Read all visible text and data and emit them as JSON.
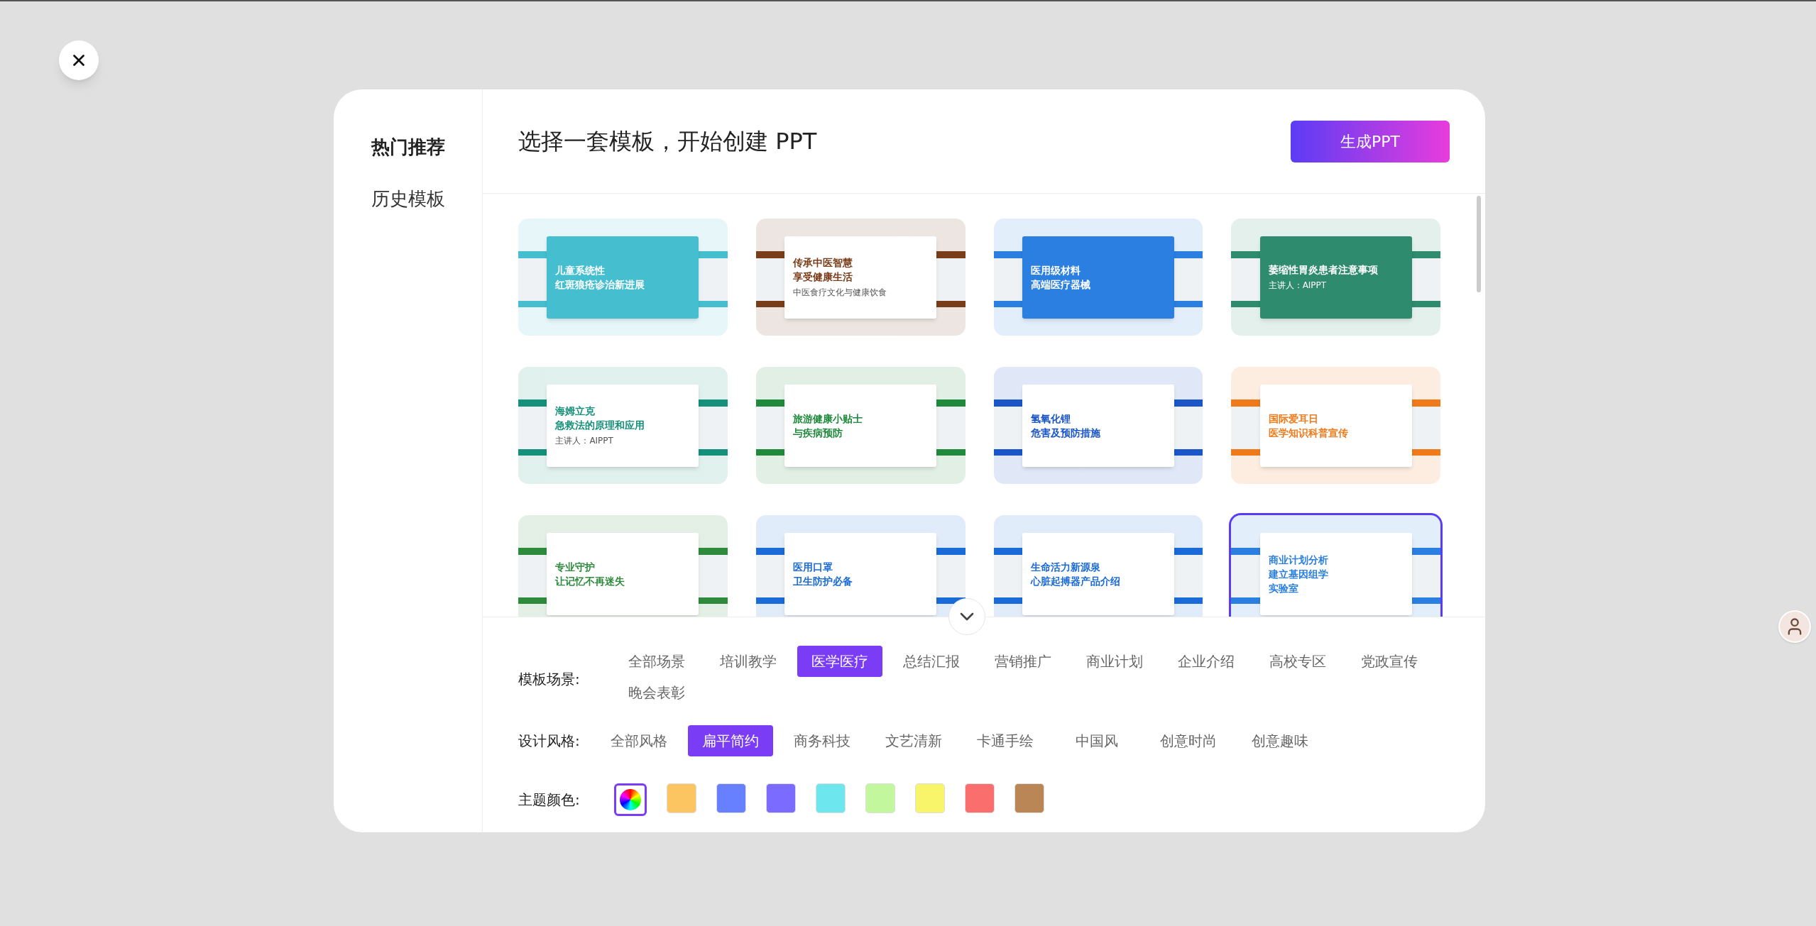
{
  "sidebar": {
    "items": [
      {
        "label": "热门推荐",
        "selected": true
      },
      {
        "label": "历史模板",
        "selected": false
      }
    ]
  },
  "header": {
    "title": "选择一套模板，开始创建 PPT",
    "generate_button": "生成PPT"
  },
  "templates": [
    {
      "kind": "filled",
      "color": "#45bfcf",
      "title_lines": [
        "儿童系统性",
        "红斑狼疮诊治新进展"
      ],
      "selected": false
    },
    {
      "kind": "plain",
      "color": "#7a3d1a",
      "title_lines": [
        "传承中医智慧",
        "享受健康生活"
      ],
      "subtitle": "中医食疗文化与健康饮食",
      "selected": false
    },
    {
      "kind": "filled",
      "color": "#2a7fe0",
      "title_lines": [
        "医用级材料",
        "高端医疗器械"
      ],
      "selected": false
    },
    {
      "kind": "filled",
      "color": "#2e8b6e",
      "title_lines": [
        "萎缩性胃炎患者注意事项"
      ],
      "subtitle": "主讲人：AIPPT",
      "selected": false
    },
    {
      "kind": "plain",
      "color": "#15907a",
      "title_lines": [
        "海姆立克",
        "急救法的原理和应用"
      ],
      "subtitle": "主讲人：AIPPT",
      "selected": false
    },
    {
      "kind": "plain",
      "color": "#1f8a3c",
      "title_lines": [
        "旅游健康小贴士",
        "与疾病预防"
      ],
      "selected": false
    },
    {
      "kind": "plain",
      "color": "#1a56c8",
      "title_lines": [
        "氢氧化锂",
        "危害及预防措施"
      ],
      "selected": false
    },
    {
      "kind": "plain",
      "color": "#f07a1a",
      "title_lines": [
        "国际爱耳日",
        "医学知识科普宣传"
      ],
      "selected": false
    },
    {
      "kind": "plain",
      "color": "#2e8b3c",
      "title_lines": [
        "专业守护",
        "让记忆不再迷失"
      ],
      "selected": false
    },
    {
      "kind": "plain",
      "color": "#1a6ad8",
      "title_lines": [
        "医用口罩",
        "卫生防护必备"
      ],
      "selected": false
    },
    {
      "kind": "plain",
      "color": "#1a6ad8",
      "title_lines": [
        "生命活力新源泉",
        "心脏起搏器产品介绍"
      ],
      "selected": false
    },
    {
      "kind": "plain",
      "color": "#2a7fe0",
      "title_lines": [
        "商业计划分析",
        "建立基因组学",
        "实验室"
      ],
      "selected": true
    }
  ],
  "filters": {
    "scene": {
      "label": "模板场景:",
      "options": [
        {
          "label": "全部场景",
          "selected": false
        },
        {
          "label": "培训教学",
          "selected": false
        },
        {
          "label": "医学医疗",
          "selected": true
        },
        {
          "label": "总结汇报",
          "selected": false
        },
        {
          "label": "营销推广",
          "selected": false
        },
        {
          "label": "商业计划",
          "selected": false
        },
        {
          "label": "企业介绍",
          "selected": false
        },
        {
          "label": "高校专区",
          "selected": false
        },
        {
          "label": "党政宣传",
          "selected": false
        },
        {
          "label": "晚会表彰",
          "selected": false
        }
      ]
    },
    "style": {
      "label": "设计风格:",
      "options": [
        {
          "label": "全部风格",
          "selected": false
        },
        {
          "label": "扁平简约",
          "selected": true
        },
        {
          "label": "商务科技",
          "selected": false
        },
        {
          "label": "文艺清新",
          "selected": false
        },
        {
          "label": "卡通手绘",
          "selected": false
        },
        {
          "label": "中国风",
          "selected": false
        },
        {
          "label": "创意时尚",
          "selected": false
        },
        {
          "label": "创意趣味",
          "selected": false
        }
      ]
    },
    "color": {
      "label": "主题颜色:",
      "swatches": [
        {
          "kind": "rainbow",
          "selected": true
        },
        {
          "kind": "solid",
          "color": "#fdc462",
          "selected": false
        },
        {
          "kind": "solid",
          "color": "#6680ff",
          "selected": false
        },
        {
          "kind": "solid",
          "color": "#7b6cff",
          "selected": false
        },
        {
          "kind": "solid",
          "color": "#6de6ee",
          "selected": false
        },
        {
          "kind": "solid",
          "color": "#c3f79e",
          "selected": false
        },
        {
          "kind": "solid",
          "color": "#f9f56a",
          "selected": false
        },
        {
          "kind": "solid",
          "color": "#fb6e6e",
          "selected": false
        },
        {
          "kind": "solid",
          "color": "#bb8655",
          "selected": false
        }
      ]
    }
  }
}
